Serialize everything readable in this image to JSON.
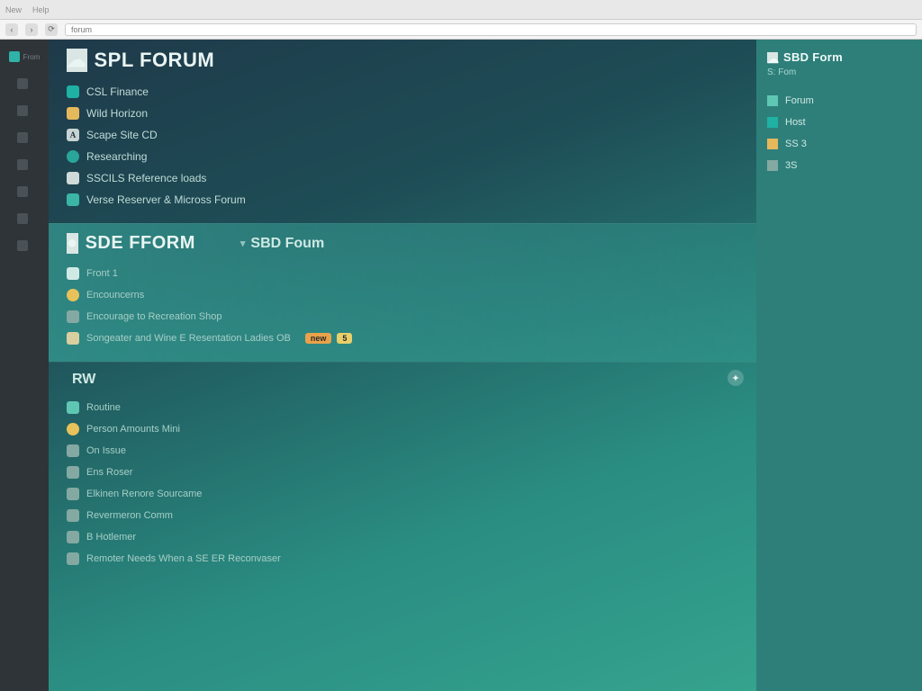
{
  "browser": {
    "tab1": "New",
    "tab2": "Help",
    "url_placeholder": "forum"
  },
  "leftbar": {
    "items": [
      {
        "label": "From",
        "teal": true
      },
      {
        "label": ""
      },
      {
        "label": ""
      },
      {
        "label": ""
      },
      {
        "label": ""
      },
      {
        "label": ""
      },
      {
        "label": ""
      },
      {
        "label": ""
      }
    ]
  },
  "section1": {
    "title": "SPL FORUM",
    "items": [
      {
        "icon": "teal",
        "label": "CSL Finance"
      },
      {
        "icon": "folder",
        "label": "Wild Horizon"
      },
      {
        "icon": "text",
        "label": "Scape Site CD"
      },
      {
        "icon": "globe",
        "label": "Researching"
      },
      {
        "icon": "card",
        "label": "SSCILS Reference loads"
      },
      {
        "icon": "box",
        "label": "Verse Reserver & Micross Forum"
      }
    ]
  },
  "section2": {
    "title_left": "SDE FFORM",
    "title_right": "SBD Foum",
    "items": [
      {
        "icon": "doc",
        "label": "Front 1"
      },
      {
        "icon": "dot",
        "label": "Encouncerns"
      },
      {
        "icon": "sqr",
        "label": "Encourage to Recreation Shop"
      },
      {
        "icon": "note",
        "label": "Songeater and Wine E Resentation Ladies OB",
        "badge1": "new",
        "badge2": "5"
      }
    ]
  },
  "section3": {
    "title": "RW",
    "items": [
      {
        "icon": "green",
        "label": "Routine"
      },
      {
        "icon": "dot",
        "label": "Person Amounts Mini"
      },
      {
        "icon": "sqr",
        "label": "On Issue"
      },
      {
        "icon": "sqr",
        "label": "Ens Roser"
      },
      {
        "icon": "sqr",
        "label": "Elkinen Renore Sourcame"
      },
      {
        "icon": "sqr",
        "label": "Revermeron Comm"
      },
      {
        "icon": "sqr",
        "label": "B Hotlemer"
      },
      {
        "icon": "sqr",
        "label": "Remoter Needs When a SE ER Reconvaser"
      }
    ]
  },
  "rightbar": {
    "title": "SBD Form",
    "sub": "S: Fom",
    "items": [
      {
        "icon": "green",
        "label": "Forum"
      },
      {
        "icon": "teal",
        "label": "Host"
      },
      {
        "icon": "folder",
        "label": "SS 3"
      },
      {
        "icon": "sqr",
        "label": "3S"
      }
    ]
  }
}
